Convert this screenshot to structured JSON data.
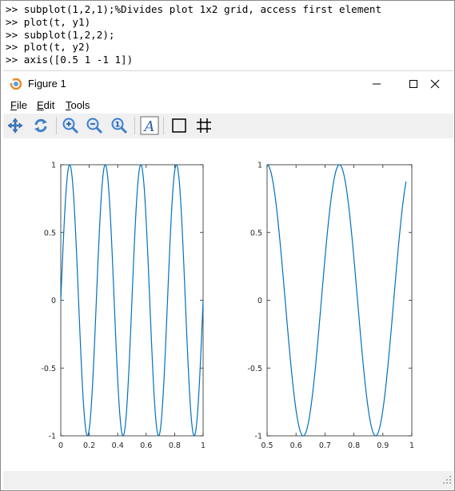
{
  "console": {
    "lines": [
      ">> subplot(1,2,1);%Divides plot 1x2 grid, access first element",
      ">> plot(t, y1)",
      ">> subplot(1,2,2);",
      ">> plot(t, y2)",
      ">> axis([0.5 1 -1 1])"
    ]
  },
  "figure_window": {
    "title": "Figure 1",
    "menu": [
      {
        "label": "File",
        "mnemonic": "F",
        "rest": "ile"
      },
      {
        "label": "Edit",
        "mnemonic": "E",
        "rest": "dit"
      },
      {
        "label": "Tools",
        "mnemonic": "T",
        "rest": "ools"
      }
    ],
    "toolbar_icons": [
      "pan-icon",
      "rotate-icon",
      "zoom-in-icon",
      "zoom-out-icon",
      "zoom-reset-icon",
      "text-insert-icon",
      "axes-box-icon",
      "grid-icon"
    ]
  },
  "colors": {
    "line": "#0072bd",
    "toolbar_bg": "#f0f0f0"
  },
  "chart_data": [
    {
      "type": "line",
      "function": "sin(2*pi*4*t)",
      "x_range": [
        0,
        1
      ],
      "xlim": [
        0,
        1
      ],
      "ylim": [
        -1,
        1
      ],
      "xticks": [
        0,
        0.2,
        0.4,
        0.6,
        0.8,
        1
      ],
      "yticks": [
        -1,
        -0.5,
        0,
        0.5,
        1
      ],
      "xtick_labels": [
        "0",
        "0.2",
        "0.4",
        "0.6",
        "0.8",
        "1"
      ],
      "ytick_labels": [
        "-1",
        "-0.5",
        "0",
        "0.5",
        "1"
      ],
      "grid": false,
      "sample_points": [
        [
          0,
          0
        ],
        [
          0.0625,
          1
        ],
        [
          0.125,
          0
        ],
        [
          0.1875,
          -1
        ],
        [
          0.25,
          0
        ],
        [
          0.3125,
          1
        ],
        [
          0.375,
          0
        ],
        [
          0.4375,
          -1
        ],
        [
          0.5,
          0
        ],
        [
          0.5625,
          1
        ],
        [
          0.625,
          0
        ],
        [
          0.6875,
          -1
        ],
        [
          0.75,
          0
        ],
        [
          0.8125,
          1
        ],
        [
          0.875,
          0
        ],
        [
          0.9375,
          -1
        ],
        [
          1.0,
          0
        ]
      ]
    },
    {
      "type": "line",
      "function": "sin(2*pi*4*t + pi/2)",
      "x_range": [
        0.5,
        0.98
      ],
      "xlim": [
        0.5,
        1
      ],
      "ylim": [
        -1,
        1
      ],
      "xticks": [
        0.5,
        0.6,
        0.7,
        0.8,
        0.9,
        1
      ],
      "yticks": [
        -1,
        -0.5,
        0,
        0.5,
        1
      ],
      "xtick_labels": [
        "0.5",
        "0.6",
        "0.7",
        "0.8",
        "0.9",
        "1"
      ],
      "ytick_labels": [
        "-1",
        "-0.5",
        "0",
        "0.5",
        "1"
      ],
      "grid": false,
      "sample_points": [
        [
          0.5,
          1
        ],
        [
          0.5625,
          0
        ],
        [
          0.625,
          -1
        ],
        [
          0.6875,
          0
        ],
        [
          0.75,
          1
        ],
        [
          0.8125,
          0
        ],
        [
          0.875,
          -1
        ],
        [
          0.9375,
          0
        ],
        [
          0.98,
          0.87
        ]
      ]
    }
  ]
}
